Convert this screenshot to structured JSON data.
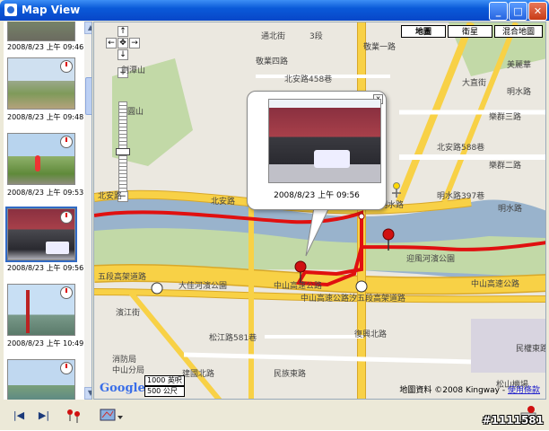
{
  "window": {
    "title": "Map View",
    "minimize": "_",
    "maximize": "□",
    "close": "✕"
  },
  "sidebar": {
    "items": [
      {
        "date": "2008/8/23 上午 09:46",
        "scene": "road"
      },
      {
        "date": "2008/8/23 上午 09:48",
        "scene": "field"
      },
      {
        "date": "2008/8/23 上午 09:53",
        "scene": "runner"
      },
      {
        "date": "2008/8/23 上午 09:56",
        "scene": "gate"
      },
      {
        "date": "2008/8/23 上午 10:49",
        "scene": "bridge"
      },
      {
        "date": "",
        "scene": "river"
      }
    ]
  },
  "map": {
    "types": [
      "地圖",
      "衛星",
      "混合地圖"
    ],
    "active_type": "地圖",
    "popup": {
      "date": "2008/8/23 上午 09:56",
      "close": "x"
    },
    "labels": [
      {
        "text": "劍潭山",
        "name": "label-jiantan"
      },
      {
        "text": "圓山",
        "name": "label-yuanshan"
      },
      {
        "text": "北安路",
        "name": "label-beian-1"
      },
      {
        "text": "北安路588巷",
        "name": "label-beian-588"
      },
      {
        "text": "北安路",
        "name": "label-beian-2"
      },
      {
        "text": "樂群三路",
        "name": "label-lequn3"
      },
      {
        "text": "樂群二路",
        "name": "label-lequn2"
      },
      {
        "text": "明水路",
        "name": "label-mingshui-1"
      },
      {
        "text": "明水路",
        "name": "label-mingshui-2"
      },
      {
        "text": "明水路397巷",
        "name": "label-mingshui-397"
      },
      {
        "text": "大直街",
        "name": "label-dazhi"
      },
      {
        "text": "明水路",
        "name": "label-mingshui-3"
      },
      {
        "text": "五段高架道路",
        "name": "label-highway-elevated"
      },
      {
        "text": "中山高速公路",
        "name": "label-zhongshan-hwy-1"
      },
      {
        "text": "中山高速公路",
        "name": "label-zhongshan-hwy-2"
      },
      {
        "text": "中山高速公路汐五段高架道路",
        "name": "label-zhongshan-hwy-xizhi"
      },
      {
        "text": "大佳河濱公園",
        "name": "label-dajia-park"
      },
      {
        "text": "迎風河濱公園",
        "name": "label-yingfeng-park"
      },
      {
        "text": "松江路581巷",
        "name": "label-songjiang-581"
      },
      {
        "text": "建國北路",
        "name": "label-jianguo-n"
      },
      {
        "text": "濱江街",
        "name": "label-binjiang"
      },
      {
        "text": "消防局",
        "name": "label-fire-dept"
      },
      {
        "text": "中山分局",
        "name": "label-police"
      },
      {
        "text": "民族東路",
        "name": "label-minzu-e"
      },
      {
        "text": "敬業一路",
        "name": "label-jingye-1"
      },
      {
        "text": "敬業四路",
        "name": "label-jingye-4"
      },
      {
        "text": "復興北路",
        "name": "label-fuxing-n"
      },
      {
        "text": "松山機場",
        "name": "label-songshan-airport"
      },
      {
        "text": "民權東路",
        "name": "label-minquan"
      },
      {
        "text": "通北街",
        "name": "label-tongbei"
      },
      {
        "text": "3段",
        "name": "label-3duan"
      },
      {
        "text": "美麗華",
        "name": "label-meilihua"
      },
      {
        "text": "北安路458巷",
        "name": "label-beian-458"
      }
    ],
    "google": "Google",
    "scale": {
      "top": "1000 英呎",
      "bottom": "500 公尺"
    },
    "copyright": {
      "text": "地圖資料 ©2008 Kingway - ",
      "link": "使用條款"
    }
  },
  "toolbar": {
    "prev": "|◀",
    "next": "▶|",
    "route_tool": "route",
    "layer_tool": "layers",
    "watermark": "#1111581"
  },
  "colors": {
    "road_yellow": "#f8d146",
    "road_outline": "#d8a82a",
    "water": "#99b3cc",
    "park": "#c2d9a7",
    "land": "#ebe8e0",
    "route": "#e01010",
    "title_blue": "#0a5ad9"
  }
}
